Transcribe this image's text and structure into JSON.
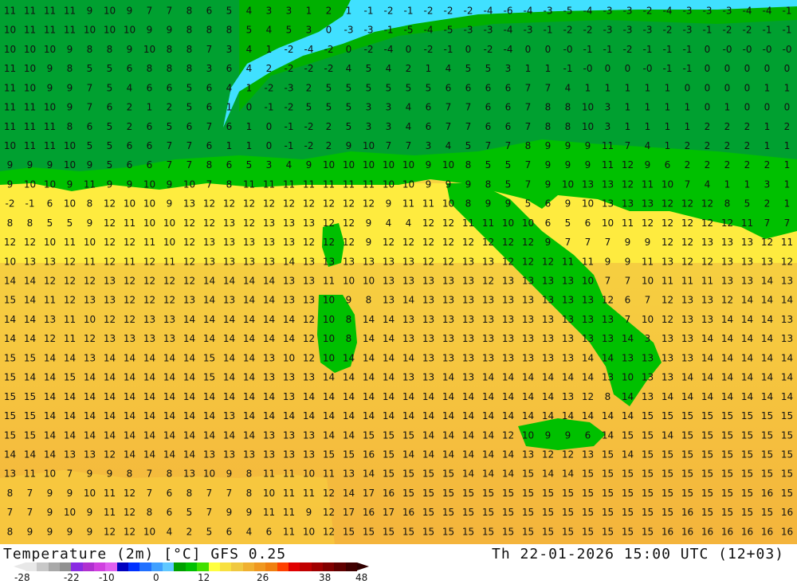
{
  "header": {
    "title_left": "Temperature (2m) [°C] GFS 0.25",
    "title_right": "Th 22-01-2026 15:00 UTC (12+03)"
  },
  "legend": {
    "tick_labels": [
      "-28",
      "-22",
      "-10",
      "0",
      "12",
      "26",
      "38",
      "48"
    ],
    "colors": [
      "#e8e8e8",
      "#c8c8c8",
      "#a8a8a8",
      "#909090",
      "#8a2be2",
      "#b030d0",
      "#d040e0",
      "#e060f0",
      "#0000c0",
      "#0030ff",
      "#2070ff",
      "#40a0ff",
      "#60c8ff",
      "#00a000",
      "#00c000",
      "#40e000",
      "#ffff40",
      "#f8e040",
      "#f0c840",
      "#f0b030",
      "#f09820",
      "#f08010",
      "#ff4000",
      "#e00000",
      "#c00000",
      "#a00000",
      "#800000",
      "#600000",
      "#400000"
    ]
  },
  "colors": {
    "sea_warm": "#f4b43c",
    "sea_mid": "#f8d040",
    "land_cool": "#00c000",
    "land_cold": "#00a030",
    "snow": "#40e0ff"
  },
  "map_values": [
    "11 11 11 11 9 10 9 7 7 8 6 5 4 3 3 1 2 1 -1 -2 -1 -2 -2 -2 -4 -6 -4 -3 -5 -4 -3 -3 -2 -4 -3 -3 -3 -4 -4 -1",
    "10 11 11 11 10 10 10 9 9 8 8 8 5 4 5 3 0 -3 -3 -1 -5 -4 -5 -3 -3 -4 -3 -1 -2 -2 -3 -3 -3 -2 -3 -1 -2 -2 -1 -1",
    "10 10 10 9 8 8 9 10 8 8 7 3 4 1 -2 -4 -2 0 -2 -4 0 -2 -1 0 -2 -4 0 0 -0 -1 -1 -2 -1 -1 -1 0 -0 -0 -0 -0",
    "11 10 9 8 5 5 6 8 8 8 3 6 4 2 -2 -2 -2 4 5 4 2 1 4 5 5 3 1 1 -1 -0 0 0 -0 -1 -1 0 0 0 0 0",
    "11 10 9 9 7 5 4 6 6 5 6 4 1 -2 -3 2 5 5 5 5 5 5 6 6 6 6 7 7 4 1 1 1 1 1 0 0 0 0 1 1",
    "11 11 10 9 7 6 2 1 2 5 6 1 0 -1 -2 5 5 5 3 3 4 6 7 7 6 6 7 8 8 10 3 1 1 1 1 0 1 0 0 0",
    "11 11 11 8 6 5 2 6 5 6 7 6 1 0 -1 -2 2 5 3 3 4 6 7 7 6 6 7 8 8 10 3 1 1 1 1 2 2 2 1 2",
    "10 11 11 10 5 5 6 6 7 7 6 1 1 0 -1 -2 2 9 10 7 7 3 4 5 7 7 8 9 9 9 11 7 4 1 2 2 2 2 1 1",
    "9 9 9 10 9 5 6 6 7 7 8 6 5 3 4 9 10 10 10 10 10 9 10 8 5 5 7 9 9 9 11 12 9 6 2 2 2 2 2 1",
    "9 10 10 9 11 9 9 10 9 10 7 8 11 11 11 11 11 11 11 10 10 9 9 9 8 5 7 9 10 13 13 12 11 10 7 4 1 1 3 1",
    "-2 -1 6 10 8 12 10 10 9 13 12 12 12 12 12 12 12 12 12 9 11 11 10 8 9 9 5 6 9 10 13 13 13 12 12 12 8 5 2 1",
    "8 8 5 5 9 12 11 10 10 12 12 13 12 13 13 13 12 12 9 4 4 12 12 11 11 10 10 6 5 6 10 11 12 12 12 12 12 11 7 7",
    "12 12 10 11 10 12 12 11 10 12 13 13 13 13 13 12 12 12 9 12 12 12 12 12 12 12 12 9 7 7 7 9 9 12 12 13 13 13 12 11",
    "10 13 13 12 11 12 11 12 11 12 13 13 13 13 14 13 13 13 13 13 13 12 12 13 13 12 12 12 11 11 9 9 11 13 12 12 13 13 13 12",
    "14 14 12 12 12 13 12 12 12 12 14 14 14 14 13 13 11 10 10 13 13 13 13 13 12 13 13 13 13 10 7 7 10 11 11 11 13 13 14 13",
    "15 14 11 12 13 13 12 12 12 13 14 13 14 14 13 13 10 9 8 13 14 13 13 13 13 13 13 13 13 13 12 6 7 12 13 13 12 14 14 14",
    "14 14 13 11 10 12 12 13 13 14 14 14 14 14 14 12 10 8 14 14 13 13 13 13 13 13 13 13 13 13 13 7 10 12 13 13 14 14 14 13",
    "14 14 12 11 12 13 13 13 13 14 14 14 14 14 14 12 10 8 14 14 13 13 13 13 13 13 13 13 13 13 13 14 3 13 13 14 14 14 14 13",
    "15 15 14 14 13 14 14 14 14 14 15 14 14 13 10 12 10 14 14 14 14 13 13 13 13 13 13 13 13 14 14 13 13 13 13 14 14 14 14 14",
    "15 14 14 15 14 14 14 14 14 14 15 14 14 13 13 13 14 14 14 14 13 13 14 13 14 14 14 14 14 14 13 10 13 13 14 14 14 14 14 14",
    "15 15 14 14 14 14 14 14 14 14 14 14 14 14 13 14 14 14 14 14 14 14 14 14 14 14 14 14 13 12 8 14 13 14 14 14 14 14 14 14",
    "15 15 14 14 14 14 14 14 14 14 14 13 14 14 14 14 14 14 14 14 14 14 14 14 14 14 14 14 14 14 14 14 15 15 15 15 15 15 15 15",
    "15 15 14 14 14 14 14 14 14 14 14 14 14 13 13 13 14 14 15 15 15 14 14 14 14 12 10 9 9 6 14 15 15 14 15 15 15 15 15 15",
    "14 14 14 13 13 12 14 14 14 14 13 13 13 13 13 13 15 15 16 15 14 14 14 14 14 14 13 12 12 13 15 14 15 15 15 15 15 15 15 15",
    "13 11 10 7 9 9 8 7 8 13 10 9 8 11 11 10 11 13 14 15 15 15 15 14 14 14 15 14 14 15 15 15 15 15 15 15 15 15 15 15",
    "8 7 9 9 10 11 12 7 6 8 7 7 8 10 11 11 12 14 17 16 15 15 15 15 15 15 15 15 15 15 15 15 15 15 15 15 15 15 16 15",
    "7 7 9 10 9 11 12 8 6 5 7 9 9 11 11 9 12 17 16 17 16 15 15 15 15 15 15 15 15 15 15 15 15 15 16 15 15 15 15 16",
    "8 9 9 9 9 12 12 10 4 2 5 6 4 6 11 10 12 15 15 15 15 15 15 15 15 15 15 15 15 15 15 15 15 16 16 16 16 16 16 16"
  ]
}
